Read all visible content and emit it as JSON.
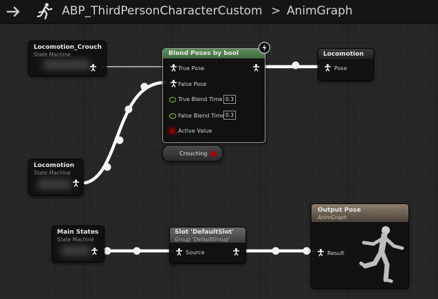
{
  "header": {
    "title": "ABP_ThirdPersonCharacterCustom",
    "separator": ">",
    "page": "AnimGraph",
    "icons": {
      "back": "arrow-right-icon",
      "character": "running-figure-icon"
    }
  },
  "nodes": {
    "locomotion_crouch": {
      "title": "Locomotion_Crouch",
      "subtitle": "State Machine"
    },
    "locomotion": {
      "title": "Locomotion",
      "subtitle": "State Machine"
    },
    "main_states": {
      "title": "Main States",
      "subtitle": "State Machine"
    },
    "blend": {
      "title": "Blend Poses by bool",
      "true_pose": "True Pose",
      "false_pose": "False Pose",
      "true_blend_label": "True Blend Time",
      "true_blend_value": "0.3",
      "false_blend_label": "False Blend Time",
      "false_blend_value": "0.3",
      "active_value": "Active Value",
      "badge": "lightning-icon"
    },
    "crouching": {
      "label": "Crouching"
    },
    "locomotion_out": {
      "title": "Locomotion",
      "pose": "Pose"
    },
    "slot": {
      "title": "Slot 'DefaultSlot'",
      "subtitle": "Group 'DefaultGroup'",
      "source": "Source"
    },
    "output": {
      "title": "Output Pose",
      "subtitle": "AnimGraph",
      "result": "Result"
    }
  },
  "colors": {
    "background": "#262626",
    "blend_header": "#4c7a4a",
    "output_header": "#7d6f60",
    "slot_header": "#5a5a5a",
    "float_pin": "#7ad230",
    "bool_pin": "#aa0000",
    "wire": "#ffffff"
  }
}
